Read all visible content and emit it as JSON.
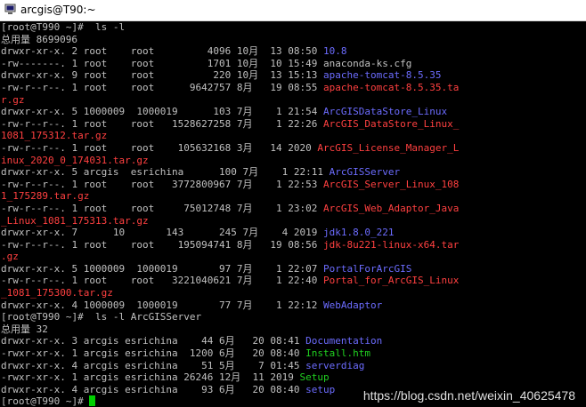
{
  "window": {
    "title": "arcgis@T90:~",
    "icon": "putty-terminal-icon"
  },
  "colors": {
    "default": "#c0c0c0",
    "dir": "#6c6cff",
    "archive": "#ff4040",
    "exec": "#20d020",
    "cursor": "#00d000",
    "background": "#000000"
  },
  "terminal": {
    "lines": [
      [
        {
          "t": "[root@T990 ~]#  ls -l",
          "c": "default"
        }
      ],
      [
        {
          "t": "总用量 8699096",
          "c": "default"
        }
      ],
      [
        {
          "t": "drwxr-xr-x. 2 root    root         4096 10月  13 08:50 ",
          "c": "default"
        },
        {
          "t": "10.8",
          "c": "dir"
        }
      ],
      [
        {
          "t": "-rw-------. 1 root    root         1701 10月  10 15:49 anaconda-ks.cfg",
          "c": "default"
        }
      ],
      [
        {
          "t": "drwxr-xr-x. 9 root    root          220 10月  13 15:13 ",
          "c": "default"
        },
        {
          "t": "apache-tomcat-8.5.35",
          "c": "dir"
        }
      ],
      [
        {
          "t": "-rw-r--r--. 1 root    root      9642757 8月   19 08:55 ",
          "c": "default"
        },
        {
          "t": "apache-tomcat-8.5.35.ta",
          "c": "archive"
        }
      ],
      [
        {
          "t": "r.gz",
          "c": "archive"
        }
      ],
      [
        {
          "t": "drwxr-xr-x. 5 1000009  1000019      103 7月    1 21:54 ",
          "c": "default"
        },
        {
          "t": "ArcGISDataStore_Linux",
          "c": "dir"
        }
      ],
      [
        {
          "t": "-rw-r--r--. 1 root    root   1528627258 7月    1 22:26 ",
          "c": "default"
        },
        {
          "t": "ArcGIS_DataStore_Linux_",
          "c": "archive"
        }
      ],
      [
        {
          "t": "1081_175312.tar.gz",
          "c": "archive"
        }
      ],
      [
        {
          "t": "-rw-r--r--. 1 root    root    105632168 3月   14 2020 ",
          "c": "default"
        },
        {
          "t": "ArcGIS_License_Manager_L",
          "c": "archive"
        }
      ],
      [
        {
          "t": "inux_2020_0_174031.tar.gz",
          "c": "archive"
        }
      ],
      [
        {
          "t": "drwxr-xr-x. 5 arcgis  esrichina      100 7月    1 22:11 ",
          "c": "default"
        },
        {
          "t": "ArcGISServer",
          "c": "dir"
        }
      ],
      [
        {
          "t": "-rw-r--r--. 1 root    root   3772800967 7月    1 22:53 ",
          "c": "default"
        },
        {
          "t": "ArcGIS_Server_Linux_108",
          "c": "archive"
        }
      ],
      [
        {
          "t": "1_175289.tar.gz",
          "c": "archive"
        }
      ],
      [
        {
          "t": "-rw-r--r--. 1 root    root     75012748 7月    1 23:02 ",
          "c": "default"
        },
        {
          "t": "ArcGIS_Web_Adaptor_Java",
          "c": "archive"
        }
      ],
      [
        {
          "t": "_Linux_1081_175313.tar.gz",
          "c": "archive"
        }
      ],
      [
        {
          "t": "drwxr-xr-x. 7      10       143      245 7月    4 2019 ",
          "c": "default"
        },
        {
          "t": "jdk1.8.0_221",
          "c": "dir"
        }
      ],
      [
        {
          "t": "-rw-r--r--. 1 root    root    195094741 8月   19 08:56 ",
          "c": "default"
        },
        {
          "t": "jdk-8u221-linux-x64.tar",
          "c": "archive"
        }
      ],
      [
        {
          "t": ".gz",
          "c": "archive"
        }
      ],
      [
        {
          "t": "drwxr-xr-x. 5 1000009  1000019       97 7月    1 22:07 ",
          "c": "default"
        },
        {
          "t": "PortalForArcGIS",
          "c": "dir"
        }
      ],
      [
        {
          "t": "-rw-r--r--. 1 root    root   3221040621 7月    1 22:40 ",
          "c": "default"
        },
        {
          "t": "Portal_for_ArcGIS_Linux",
          "c": "archive"
        }
      ],
      [
        {
          "t": "_1081_175300.tar.gz",
          "c": "archive"
        }
      ],
      [
        {
          "t": "drwxr-xr-x. 4 1000009  1000019       77 7月    1 22:12 ",
          "c": "default"
        },
        {
          "t": "WebAdaptor",
          "c": "dir"
        }
      ],
      [
        {
          "t": "[root@T990 ~]#  ls -l ArcGISServer",
          "c": "default"
        }
      ],
      [
        {
          "t": "总用量 32",
          "c": "default"
        }
      ],
      [
        {
          "t": "drwxr-xr-x. 3 arcgis esrichina    44 6月   20 08:41 ",
          "c": "default"
        },
        {
          "t": "Documentation",
          "c": "dir"
        }
      ],
      [
        {
          "t": "-rwxr-xr-x. 1 arcgis esrichina  1200 6月   20 08:40 ",
          "c": "default"
        },
        {
          "t": "Install.htm",
          "c": "exec"
        }
      ],
      [
        {
          "t": "drwxr-xr-x. 4 arcgis esrichina    51 5月    7 01:45 ",
          "c": "default"
        },
        {
          "t": "serverdiag",
          "c": "dir"
        }
      ],
      [
        {
          "t": "-rwxr-xr-x. 1 arcgis esrichina 26246 12月  11 2019 ",
          "c": "default"
        },
        {
          "t": "Setup",
          "c": "exec"
        }
      ],
      [
        {
          "t": "drwxr-xr-x. 4 arcgis esrichina    93 6月   20 08:40 ",
          "c": "default"
        },
        {
          "t": "setup",
          "c": "dir"
        }
      ],
      [
        {
          "t": "[root@T990 ~]# ",
          "c": "default"
        }
      ]
    ]
  },
  "watermark": "https://blog.csdn.net/weixin_40625478"
}
